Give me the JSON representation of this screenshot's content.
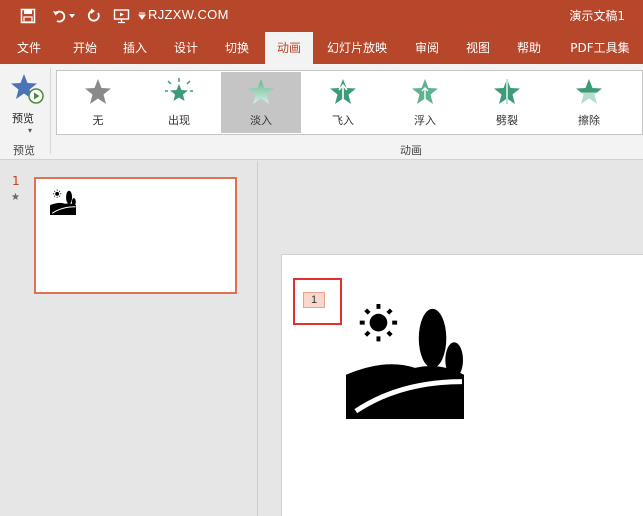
{
  "titlebar": {
    "site": "RJZXW.COM",
    "doc_title": "演示文稿1"
  },
  "tabs": [
    {
      "label": "文件"
    },
    {
      "label": "开始"
    },
    {
      "label": "插入"
    },
    {
      "label": "设计"
    },
    {
      "label": "切换"
    },
    {
      "label": "动画",
      "active": true
    },
    {
      "label": "幻灯片放映"
    },
    {
      "label": "审阅"
    },
    {
      "label": "视图"
    },
    {
      "label": "帮助"
    },
    {
      "label": "PDF工具集"
    }
  ],
  "ribbon": {
    "preview_label": "预览",
    "preview_group": "预览",
    "animation_group": "动画",
    "effects": [
      {
        "label": "无"
      },
      {
        "label": "出现"
      },
      {
        "label": "淡入",
        "selected": true
      },
      {
        "label": "飞入"
      },
      {
        "label": "浮入"
      },
      {
        "label": "劈裂"
      },
      {
        "label": "擦除"
      }
    ]
  },
  "slides_pane": {
    "slide_number": "1",
    "star": "★"
  },
  "canvas": {
    "animation_tag": "1"
  },
  "colors": {
    "accent": "#b7472a",
    "selection_border": "#e07055",
    "highlight_box": "#e0312c"
  }
}
